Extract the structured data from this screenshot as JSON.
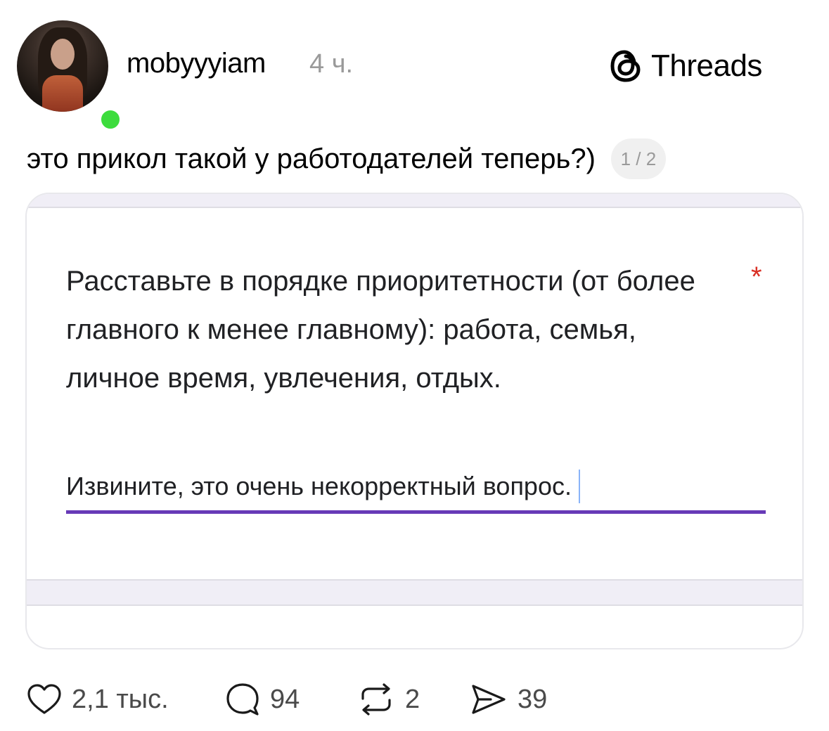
{
  "post": {
    "username": "mobyyyiam",
    "time": "4 ч.",
    "online": true,
    "caption": "это прикол такой у работодателей теперь?)",
    "page_indicator": "1 / 2"
  },
  "brand": {
    "name": "Threads",
    "icon": "threads-logo-icon"
  },
  "form_card": {
    "question": "Расставьте в порядке приоритетности (от более главного к менее главному): работа, семья, личное время, увлечения, отдых.",
    "required_mark": "*",
    "answer": "Извините, это очень некорректный вопрос.",
    "accent_color": "#673ab7",
    "required_color": "#d93025"
  },
  "actions": {
    "likes": {
      "icon": "heart-icon",
      "count": "2,1 тыс."
    },
    "replies": {
      "icon": "comment-icon",
      "count": "94"
    },
    "reposts": {
      "icon": "repost-icon",
      "count": "2"
    },
    "shares": {
      "icon": "send-icon",
      "count": "39"
    }
  },
  "colors": {
    "online_indicator": "#3ddc3d",
    "muted_text": "#9a9a9a"
  }
}
